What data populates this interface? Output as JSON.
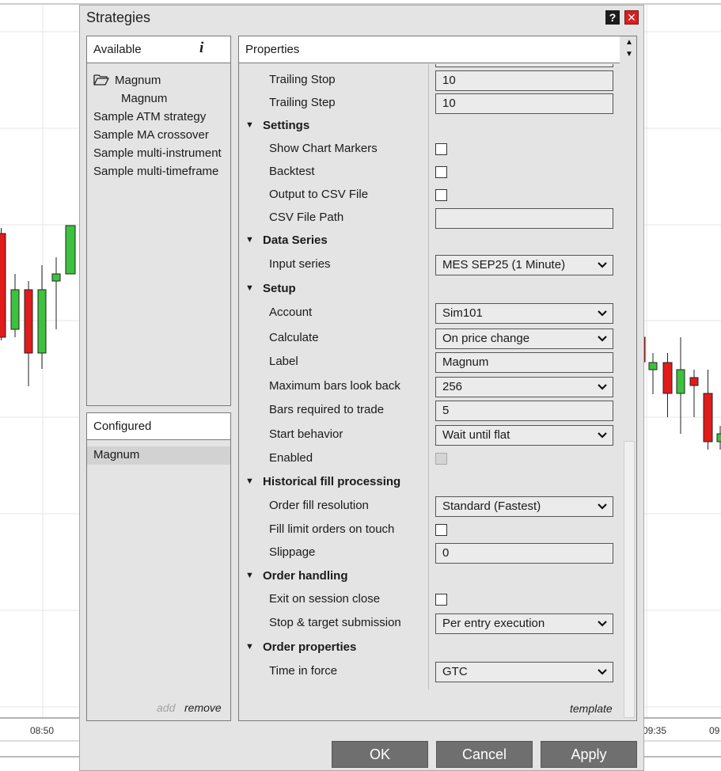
{
  "chart": {
    "time_labels": [
      "08:50",
      "09:35",
      "09"
    ]
  },
  "dialog": {
    "title": "Strategies",
    "help_icon": "?",
    "close_icon": "✕"
  },
  "available": {
    "header": "Available",
    "info_icon": "i",
    "folder_icon": "folder-icon",
    "folder": "Magnum",
    "folder_child": "Magnum",
    "items": [
      "Sample ATM strategy",
      "Sample MA crossover",
      "Sample multi-instrument",
      "Sample multi-timeframe"
    ]
  },
  "configured": {
    "header": "Configured",
    "selected": "Magnum",
    "add": "add",
    "remove": "remove"
  },
  "properties": {
    "header": "Properties",
    "template": "template",
    "rows": [
      {
        "type": "prop",
        "label": "Trailing Stop",
        "control": "text",
        "value": "10"
      },
      {
        "type": "prop",
        "label": "Trailing Step",
        "control": "text",
        "value": "10"
      },
      {
        "type": "cat",
        "label": "Settings"
      },
      {
        "type": "prop",
        "label": "Show Chart Markers",
        "control": "check",
        "checked": false
      },
      {
        "type": "prop",
        "label": "Backtest",
        "control": "check",
        "checked": false
      },
      {
        "type": "prop",
        "label": "Output to CSV File",
        "control": "check",
        "checked": false
      },
      {
        "type": "prop",
        "label": "CSV File Path",
        "control": "text",
        "value": ""
      },
      {
        "type": "cat",
        "label": "Data Series"
      },
      {
        "type": "prop",
        "label": "Input series",
        "control": "select",
        "value": "MES SEP25 (1 Minute)"
      },
      {
        "type": "cat",
        "label": "Setup"
      },
      {
        "type": "prop",
        "label": "Account",
        "control": "select",
        "value": "Sim101"
      },
      {
        "type": "prop",
        "label": "Calculate",
        "control": "select",
        "value": "On price change"
      },
      {
        "type": "prop",
        "label": "Label",
        "control": "text",
        "value": "Magnum"
      },
      {
        "type": "prop",
        "label": "Maximum bars look back",
        "control": "select",
        "value": "256"
      },
      {
        "type": "prop",
        "label": "Bars required to trade",
        "control": "text",
        "value": "5"
      },
      {
        "type": "prop",
        "label": "Start behavior",
        "control": "select",
        "value": "Wait until flat"
      },
      {
        "type": "prop",
        "label": "Enabled",
        "control": "check",
        "checked": false,
        "disabled": true
      },
      {
        "type": "cat",
        "label": "Historical fill processing"
      },
      {
        "type": "prop",
        "label": "Order fill resolution",
        "control": "select",
        "value": "Standard (Fastest)"
      },
      {
        "type": "prop",
        "label": "Fill limit orders on touch",
        "control": "check",
        "checked": false
      },
      {
        "type": "prop",
        "label": "Slippage",
        "control": "text",
        "value": "0"
      },
      {
        "type": "cat",
        "label": "Order handling"
      },
      {
        "type": "prop",
        "label": "Exit on session close",
        "control": "check",
        "checked": false
      },
      {
        "type": "prop",
        "label": "Stop & target submission",
        "control": "select",
        "value": "Per entry execution"
      },
      {
        "type": "cat",
        "label": "Order properties"
      },
      {
        "type": "prop",
        "label": "Time in force",
        "control": "select",
        "value": "GTC"
      }
    ]
  },
  "buttons": {
    "ok": "OK",
    "cancel": "Cancel",
    "apply": "Apply"
  }
}
